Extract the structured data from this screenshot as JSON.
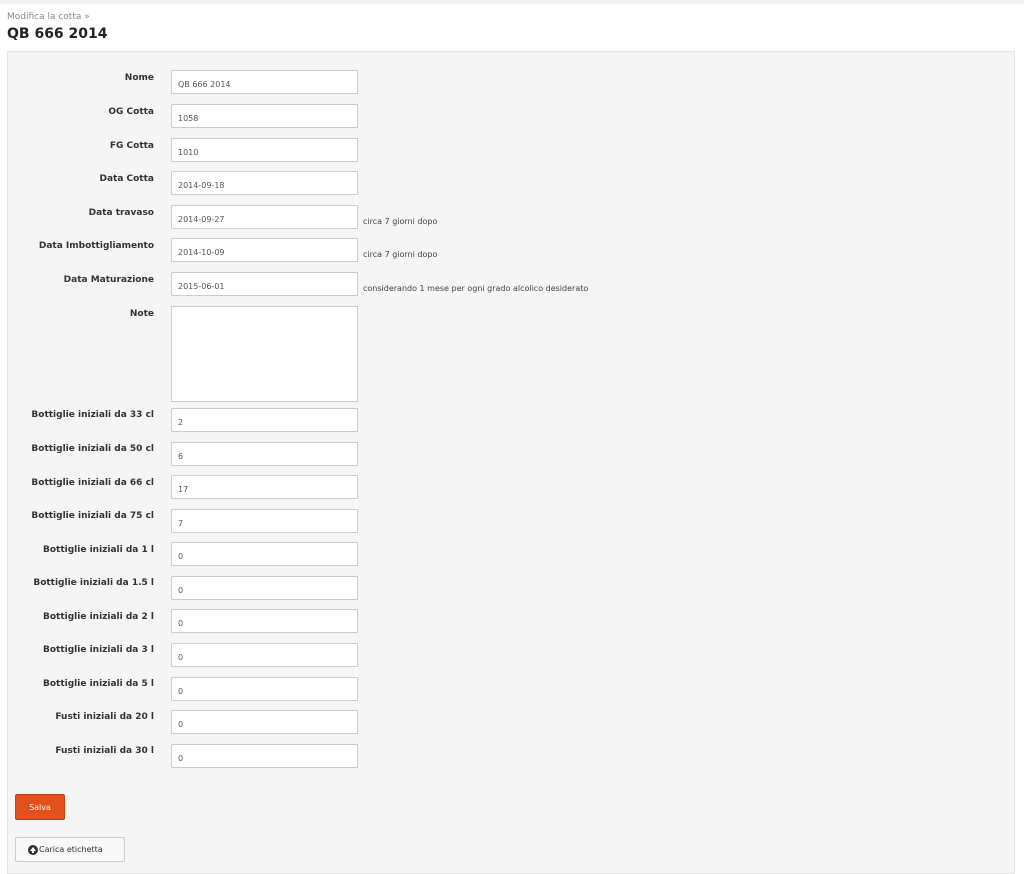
{
  "breadcrumb": "Modifica la cotta »",
  "title": "QB 666 2014",
  "fields": [
    {
      "label": "Nome",
      "value": "QB 666 2014"
    },
    {
      "label": "OG Cotta",
      "value": "1058"
    },
    {
      "label": "FG Cotta",
      "value": "1010"
    },
    {
      "label": "Data Cotta",
      "value": "2014-09-18"
    },
    {
      "label": "Data travaso",
      "value": "2014-09-27",
      "hint": "circa 7 giorni dopo"
    },
    {
      "label": "Data Imbottigliamento",
      "value": "2014-10-09",
      "hint": "circa 7 giorni dopo"
    },
    {
      "label": "Data Maturazione",
      "value": "2015-06-01",
      "hint": "considerando 1 mese per ogni grado alcolico desiderato"
    }
  ],
  "note": {
    "label": "Note",
    "value": ""
  },
  "bottles": [
    {
      "label": "Bottiglie iniziali da 33 cl",
      "value": "2"
    },
    {
      "label": "Bottiglie iniziali da 50 cl",
      "value": "6"
    },
    {
      "label": "Bottiglie iniziali da 66 cl",
      "value": "17"
    },
    {
      "label": "Bottiglie iniziali da 75 cl",
      "value": "7"
    },
    {
      "label": "Bottiglie iniziali da 1 l",
      "value": "0"
    },
    {
      "label": "Bottiglie iniziali da 1.5 l",
      "value": "0"
    },
    {
      "label": "Bottiglie iniziali da 2 l",
      "value": "0"
    },
    {
      "label": "Bottiglie iniziali da 3 l",
      "value": "0"
    },
    {
      "label": "Bottiglie iniziali da 5 l",
      "value": "0"
    },
    {
      "label": "Fusti iniziali da 20 l",
      "value": "0"
    },
    {
      "label": "Fusti iniziali da 30 l",
      "value": "0"
    }
  ],
  "buttons": {
    "save_label": "Salva",
    "upload_label": "Carica etichetta",
    "upload_icon": "circle-arrow-up-icon"
  },
  "colors": {
    "accent": "#e2511d",
    "panel": "#f5f5f5"
  }
}
